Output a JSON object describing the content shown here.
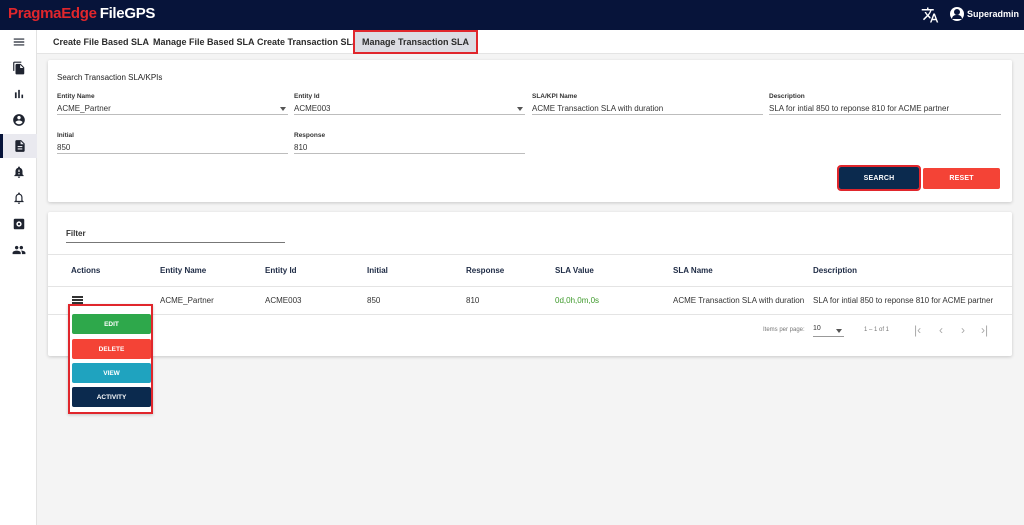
{
  "app": {
    "brand_primary": "PragmaEdge",
    "brand_secondary": "FileGPS",
    "user": "Superadmin"
  },
  "colors": {
    "navy": "#07143a",
    "red": "#e0262c",
    "edit": "#2ea84b",
    "delete": "#f44336",
    "view": "#1fa3bf",
    "activity": "#0b2a4e",
    "sla_value": "#3e9a2b"
  },
  "sidebar": {
    "items": [
      {
        "icon": "hamburger-icon"
      },
      {
        "icon": "files-icon"
      },
      {
        "icon": "bar-chart-icon"
      },
      {
        "icon": "account-circle-icon"
      },
      {
        "icon": "document-icon",
        "active": true
      },
      {
        "icon": "alert-bell-icon"
      },
      {
        "icon": "notification-bell-icon"
      },
      {
        "icon": "settings-box-icon"
      },
      {
        "icon": "group-icon"
      }
    ]
  },
  "tabs": [
    {
      "label": "Create File Based SLA"
    },
    {
      "label": "Manage File Based SLA"
    },
    {
      "label": "Create Transaction SLA"
    },
    {
      "label": "Manage Transaction SLA",
      "active": true
    }
  ],
  "search": {
    "title": "Search Transaction SLA/KPIs",
    "fields": [
      {
        "label": "Entity Name",
        "value": "ACME_Partner"
      },
      {
        "label": "Entity Id",
        "value": "ACME003"
      },
      {
        "label": "SLA/KPI Name",
        "value": "ACME Transaction SLA with duration"
      },
      {
        "label": "Description",
        "value": "SLA for intial 850 to reponse 810 for ACME partner"
      },
      {
        "label": "Initial",
        "value": "850"
      },
      {
        "label": "Response",
        "value": "810"
      }
    ],
    "search_label": "SEARCH",
    "reset_label": "RESET"
  },
  "table": {
    "filter_label": "Filter",
    "columns": [
      "Actions",
      "Entity Name",
      "Entity Id",
      "Initial",
      "Response",
      "SLA Value",
      "SLA Name",
      "Description"
    ],
    "rows": [
      {
        "entity_name": "ACME_Partner",
        "entity_id": "ACME003",
        "initial": "850",
        "response": "810",
        "sla_value": "0d,0h,0m,0s",
        "sla_name": "ACME Transaction SLA with duration",
        "description": "SLA for intial 850 to reponse 810 for ACME partner"
      }
    ],
    "paginator": {
      "items_per_page_label": "Items per page:",
      "page_size": "10",
      "range": "1 – 1 of 1"
    }
  },
  "action_menu": {
    "edit": "EDIT",
    "delete": "DELETE",
    "view": "VIEW",
    "activity": "ACTIVITY"
  }
}
